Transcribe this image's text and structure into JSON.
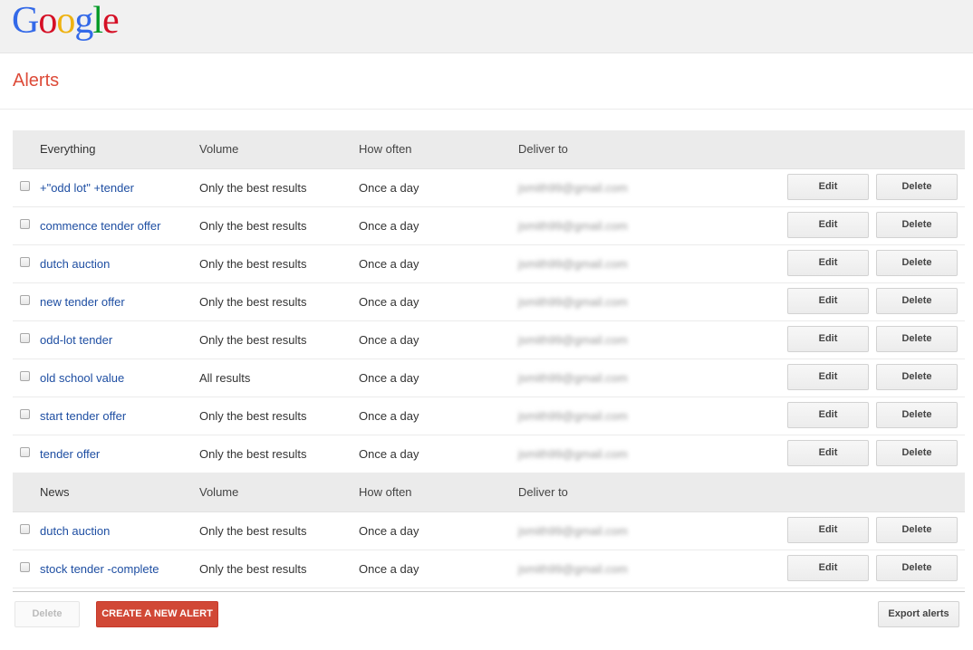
{
  "header": {
    "logo_letters": [
      "G",
      "o",
      "o",
      "g",
      "l",
      "e"
    ]
  },
  "page": {
    "title": "Alerts"
  },
  "columns": {
    "volume": "Volume",
    "how_often": "How often",
    "deliver_to": "Deliver to"
  },
  "groups": [
    {
      "name": "Everything",
      "alerts": [
        {
          "query": "+\"odd lot\" +tender",
          "volume": "Only the best results",
          "how_often": "Once a day",
          "deliver_to": "jsmith99@gmail.com"
        },
        {
          "query": "commence tender offer",
          "volume": "Only the best results",
          "how_often": "Once a day",
          "deliver_to": "jsmith99@gmail.com"
        },
        {
          "query": "dutch auction",
          "volume": "Only the best results",
          "how_often": "Once a day",
          "deliver_to": "jsmith99@gmail.com"
        },
        {
          "query": "new tender offer",
          "volume": "Only the best results",
          "how_often": "Once a day",
          "deliver_to": "jsmith99@gmail.com"
        },
        {
          "query": "odd-lot tender",
          "volume": "Only the best results",
          "how_often": "Once a day",
          "deliver_to": "jsmith99@gmail.com"
        },
        {
          "query": "old school value",
          "volume": "All results",
          "how_often": "Once a day",
          "deliver_to": "jsmith99@gmail.com"
        },
        {
          "query": "start tender offer",
          "volume": "Only the best results",
          "how_often": "Once a day",
          "deliver_to": "jsmith99@gmail.com"
        },
        {
          "query": "tender offer",
          "volume": "Only the best results",
          "how_often": "Once a day",
          "deliver_to": "jsmith99@gmail.com"
        }
      ]
    },
    {
      "name": "News",
      "alerts": [
        {
          "query": "dutch auction",
          "volume": "Only the best results",
          "how_often": "Once a day",
          "deliver_to": "jsmith99@gmail.com"
        },
        {
          "query": "stock tender -complete",
          "volume": "Only the best results",
          "how_often": "Once a day",
          "deliver_to": "jsmith99@gmail.com"
        }
      ]
    }
  ],
  "row_actions": {
    "edit": "Edit",
    "delete": "Delete"
  },
  "footer": {
    "delete": "Delete",
    "create": "CREATE A NEW ALERT",
    "export": "Export alerts"
  }
}
